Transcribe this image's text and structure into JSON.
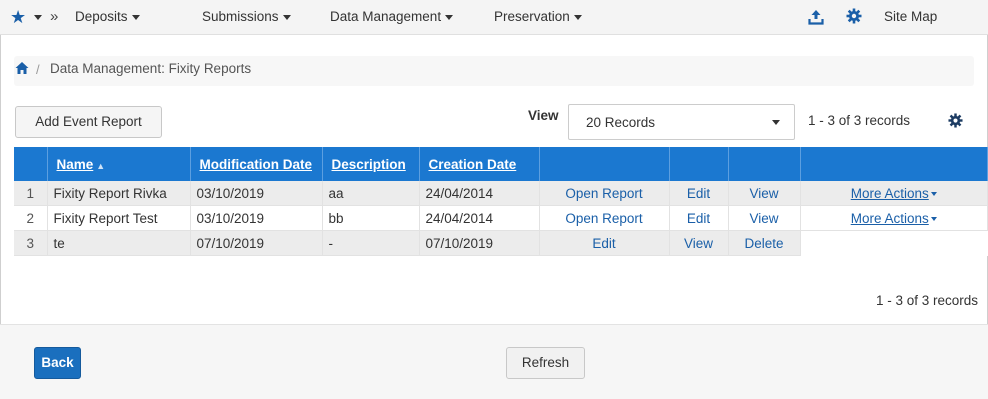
{
  "nav": {
    "items": [
      {
        "label": "Deposits"
      },
      {
        "label": "Submissions"
      },
      {
        "label": "Data Management"
      },
      {
        "label": "Preservation"
      }
    ],
    "site_map": "Site Map",
    "accent_color": "#1a5fa8",
    "icons": [
      "star-icon",
      "double-chevron-icon",
      "upload-icon",
      "gear-icon"
    ]
  },
  "breadcrumb": {
    "separator": "/",
    "current": "Data Management: Fixity Reports"
  },
  "toolbar": {
    "add_event_report": "Add Event Report",
    "view_label": "View",
    "view_select_value": "20 Records",
    "record_count": "1 - 3 of 3 records"
  },
  "table": {
    "header_color": "#1b78d0",
    "columns": [
      "Name",
      "Modification Date",
      "Description",
      "Creation Date"
    ],
    "sort_indicator": "▲",
    "rows": [
      {
        "num": "1",
        "name": "Fixity Report Rivka",
        "modified": "03/10/2019",
        "description": "aa",
        "created": "24/04/2014",
        "a1": "Open Report",
        "a2": "Edit",
        "a3": "View",
        "more": "More Actions"
      },
      {
        "num": "2",
        "name": "Fixity Report Test",
        "modified": "03/10/2019",
        "description": "bb",
        "created": "24/04/2014",
        "a1": "Open Report",
        "a2": "Edit",
        "a3": "View",
        "more": "More Actions"
      },
      {
        "num": "3",
        "name": "te",
        "modified": "07/10/2019",
        "description": "-",
        "created": "07/10/2019",
        "a1": "Edit",
        "a2": "View",
        "a3": "Delete",
        "more": ""
      }
    ]
  },
  "bottom_record_count": "1 - 3 of 3 records",
  "footer": {
    "back": "Back",
    "refresh": "Refresh"
  }
}
